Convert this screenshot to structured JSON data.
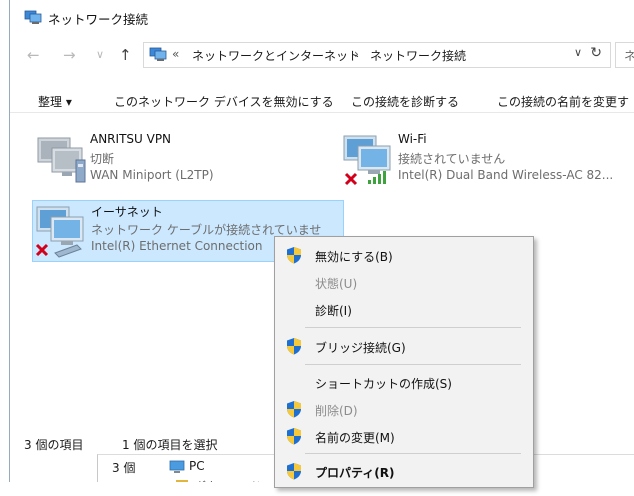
{
  "window": {
    "title": "ネットワーク接続"
  },
  "address": {
    "overflow": "«",
    "crumb1": "ネットワークとインターネット",
    "sep": "›",
    "crumb2": "ネットワーク接続",
    "search_placeholder": "ネ"
  },
  "nav": {
    "back": "←",
    "forward": "→",
    "recent": "∨",
    "up": "↑",
    "dropdown": "∨",
    "refresh": "↻"
  },
  "toolbar": {
    "organize": "整理 ▾",
    "disable": "このネットワーク デバイスを無効にする",
    "diagnose": "この接続を診断する",
    "rename": "この接続の名前を変更す"
  },
  "connections": [
    {
      "name": "ANRITSU VPN",
      "status": "切断",
      "device": "WAN Miniport (L2TP)"
    },
    {
      "name": "Wi-Fi",
      "status": "接続されていません",
      "device": "Intel(R) Dual Band Wireless-AC 82..."
    },
    {
      "name": "イーサネット",
      "status": "ネットワーク ケーブルが接続されていませ",
      "device": "Intel(R) Ethernet Connection"
    }
  ],
  "statusbar": {
    "count": "3 個の項目",
    "selected": "1 個の項目を選択"
  },
  "behind": {
    "count": "3 個",
    "pc": "PC",
    "downloads": "ダウンロード"
  },
  "context_menu": {
    "items": [
      {
        "label": "無効にする(B)",
        "shield": true,
        "disabled": false
      },
      {
        "label": "状態(U)",
        "shield": false,
        "disabled": true
      },
      {
        "label": "診断(I)",
        "shield": false,
        "disabled": false
      },
      {
        "label": "ブリッジ接続(G)",
        "shield": true,
        "disabled": false
      },
      {
        "label": "ショートカットの作成(S)",
        "shield": false,
        "disabled": false
      },
      {
        "label": "削除(D)",
        "shield": true,
        "disabled": true
      },
      {
        "label": "名前の変更(M)",
        "shield": true,
        "disabled": false
      },
      {
        "label": "プロパティ(R)",
        "shield": true,
        "disabled": false
      }
    ]
  },
  "colors": {
    "selection": "#cce8ff",
    "accent": "#0078d7",
    "disconnect_x": "#d3001b"
  }
}
